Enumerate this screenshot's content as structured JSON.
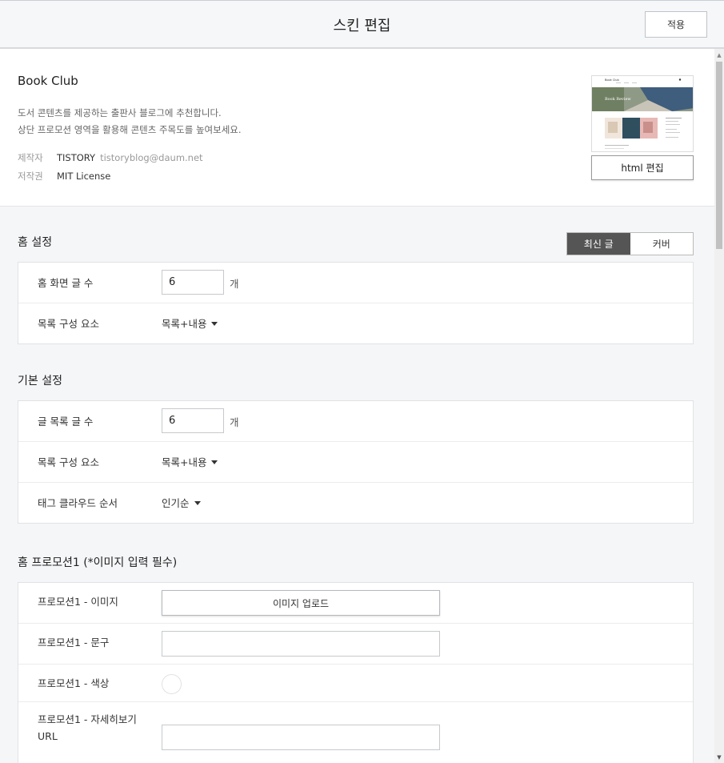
{
  "header": {
    "title": "스킨 편집",
    "apply_label": "적용"
  },
  "skin": {
    "name": "Book Club",
    "desc_line1": "도서 콘텐츠를 제공하는 출판사 블로그에 추천합니다.",
    "desc_line2": "상단 프로모션 영역을 활용해 콘텐츠 주목도를 높여보세요.",
    "maker_label": "제작자",
    "maker_name": "TISTORY",
    "maker_email": "tistoryblog@daum.net",
    "license_label": "저작권",
    "license_value": "MIT License",
    "html_edit_label": "html 편집",
    "thumb_blog_title": "Book Club",
    "thumb_banner_text": "Book Review"
  },
  "home_settings": {
    "title": "홈 설정",
    "toggle": [
      "최신 글",
      "커버"
    ],
    "toggle_active": 0,
    "post_count_label": "홈 화면 글 수",
    "post_count_value": "6",
    "unit": "개",
    "list_elements_label": "목록 구성 요소",
    "list_elements_value": "목록+내용"
  },
  "basic_settings": {
    "title": "기본 설정",
    "post_count_label": "글 목록 글 수",
    "post_count_value": "6",
    "unit": "개",
    "list_elements_label": "목록 구성 요소",
    "list_elements_value": "목록+내용",
    "tag_order_label": "태그 클라우드 순서",
    "tag_order_value": "인기순"
  },
  "promotion1": {
    "title": "홈 프로모션1 (*이미지 입력 필수)",
    "image_label": "프로모션1 - 이미지",
    "upload_label": "이미지 업로드",
    "phrase_label": "프로모션1 - 문구",
    "color_label": "프로모션1 - 색상",
    "url_label_line1": "프로모션1 - 자세히보기",
    "url_label_line2": "URL"
  },
  "colors": {
    "accent_dark": "#555555",
    "thumb_green": "#7a8a6a",
    "thumb_blue": "#3f5d7d"
  }
}
